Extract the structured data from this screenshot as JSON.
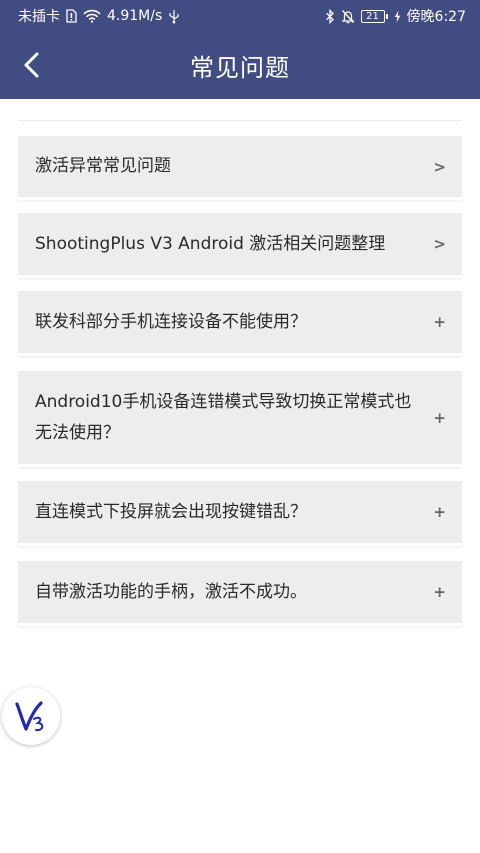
{
  "status_bar": {
    "carrier": "未插卡",
    "network_speed": "4.91M/s",
    "battery_level": "21",
    "time": "傍晚6:27"
  },
  "header": {
    "title": "常见问题"
  },
  "faq": {
    "items": [
      {
        "question": "激活异常常见问题",
        "mark": ">"
      },
      {
        "question": "ShootingPlus V3 Android 激活相关问题整理",
        "mark": ">"
      },
      {
        "question": "联发科部分手机连接设备不能使用？",
        "mark": "+"
      },
      {
        "question": "Android10手机设备连错模式导致切换正常模式也无法使用？",
        "mark": "+"
      },
      {
        "question": "直连模式下投屏就会出现按键错乱？",
        "mark": "+"
      },
      {
        "question": "自带激活功能的手柄，激活不成功。",
        "mark": "+"
      }
    ]
  },
  "colors": {
    "header_bg": "#414d82",
    "item_bg": "#ededed",
    "logo_blue": "#1c2bb0"
  },
  "icons": [
    "sim-icon",
    "wifi-icon",
    "usb-icon",
    "bluetooth-icon",
    "mute-bell-icon",
    "charging-icon",
    "back-arrow-icon",
    "v3-logo-icon"
  ]
}
